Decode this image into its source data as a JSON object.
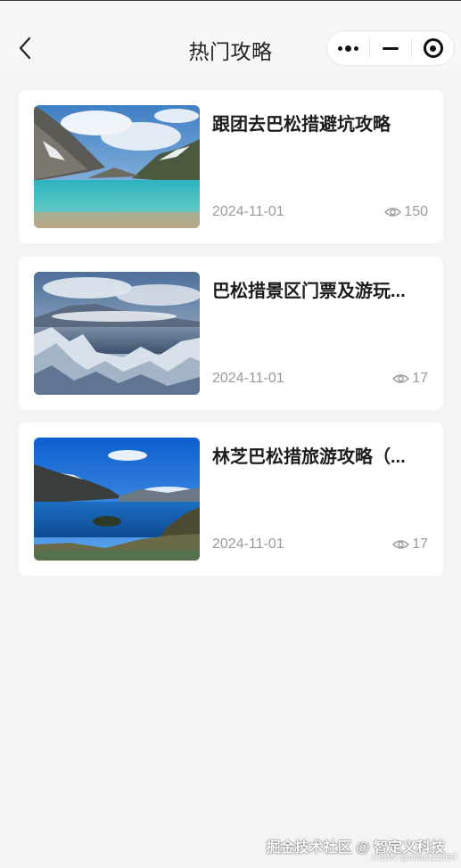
{
  "header": {
    "title": "热门攻略"
  },
  "articles": [
    {
      "title": "跟团去巴松措避坑攻略",
      "date": "2024-11-01",
      "views": "150"
    },
    {
      "title": "巴松措景区门票及游玩...",
      "date": "2024-11-01",
      "views": "17"
    },
    {
      "title": "林芝巴松措旅游攻略（...",
      "date": "2024-11-01",
      "views": "17"
    }
  ],
  "footer": {
    "watermark": "掘金技术社区 @ 智定义科技",
    "watermark_small": "CSDN @antai123987"
  },
  "colors": {
    "background": "#f4f4f4",
    "card": "#ffffff",
    "title_text": "#1c1c1c",
    "meta_text": "#9a9a9a"
  },
  "icons": {
    "back": "chevron-left-icon",
    "more": "more-dots-icon",
    "minimize": "minus-icon",
    "close": "target-circle-icon",
    "views": "eye-icon"
  }
}
